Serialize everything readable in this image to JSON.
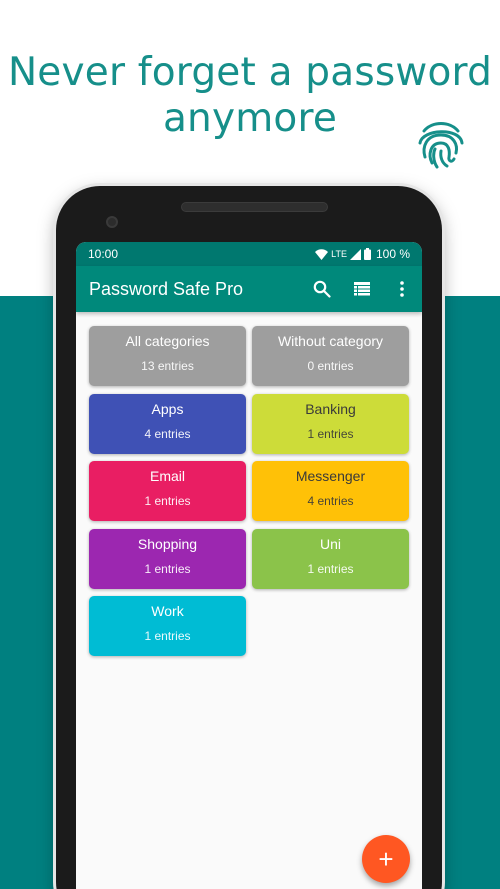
{
  "headline": {
    "line1": "Never forget a password",
    "line2": "anymore"
  },
  "status_bar": {
    "time": "10:00",
    "network": "LTE",
    "battery": "100 %"
  },
  "app_bar": {
    "title": "Password Safe Pro",
    "icons": [
      "search-icon",
      "list-view-icon",
      "more-vert-icon"
    ]
  },
  "categories": [
    {
      "name": "All categories",
      "count": "13 entries",
      "color": "#9e9e9e"
    },
    {
      "name": "Without category",
      "count": "0 entries",
      "color": "#9e9e9e"
    },
    {
      "name": "Apps",
      "count": "4 entries",
      "color": "#3f51b5"
    },
    {
      "name": "Banking",
      "count": "1 entries",
      "color": "#cddc39"
    },
    {
      "name": "Email",
      "count": "1 entries",
      "color": "#e91e63"
    },
    {
      "name": "Messenger",
      "count": "4 entries",
      "color": "#ffc107"
    },
    {
      "name": "Shopping",
      "count": "1 entries",
      "color": "#9c27b0"
    },
    {
      "name": "Uni",
      "count": "1 entries",
      "color": "#8bc34a"
    },
    {
      "name": "Work",
      "count": "1 entries",
      "color": "#00bcd4"
    }
  ],
  "fab": {
    "label": "+",
    "icon": "add-icon",
    "color": "#ff5722"
  },
  "colors": {
    "teal_band": "#008080",
    "app_bar": "#00897b",
    "status_bar": "#00786f",
    "headline": "#168f8a"
  }
}
